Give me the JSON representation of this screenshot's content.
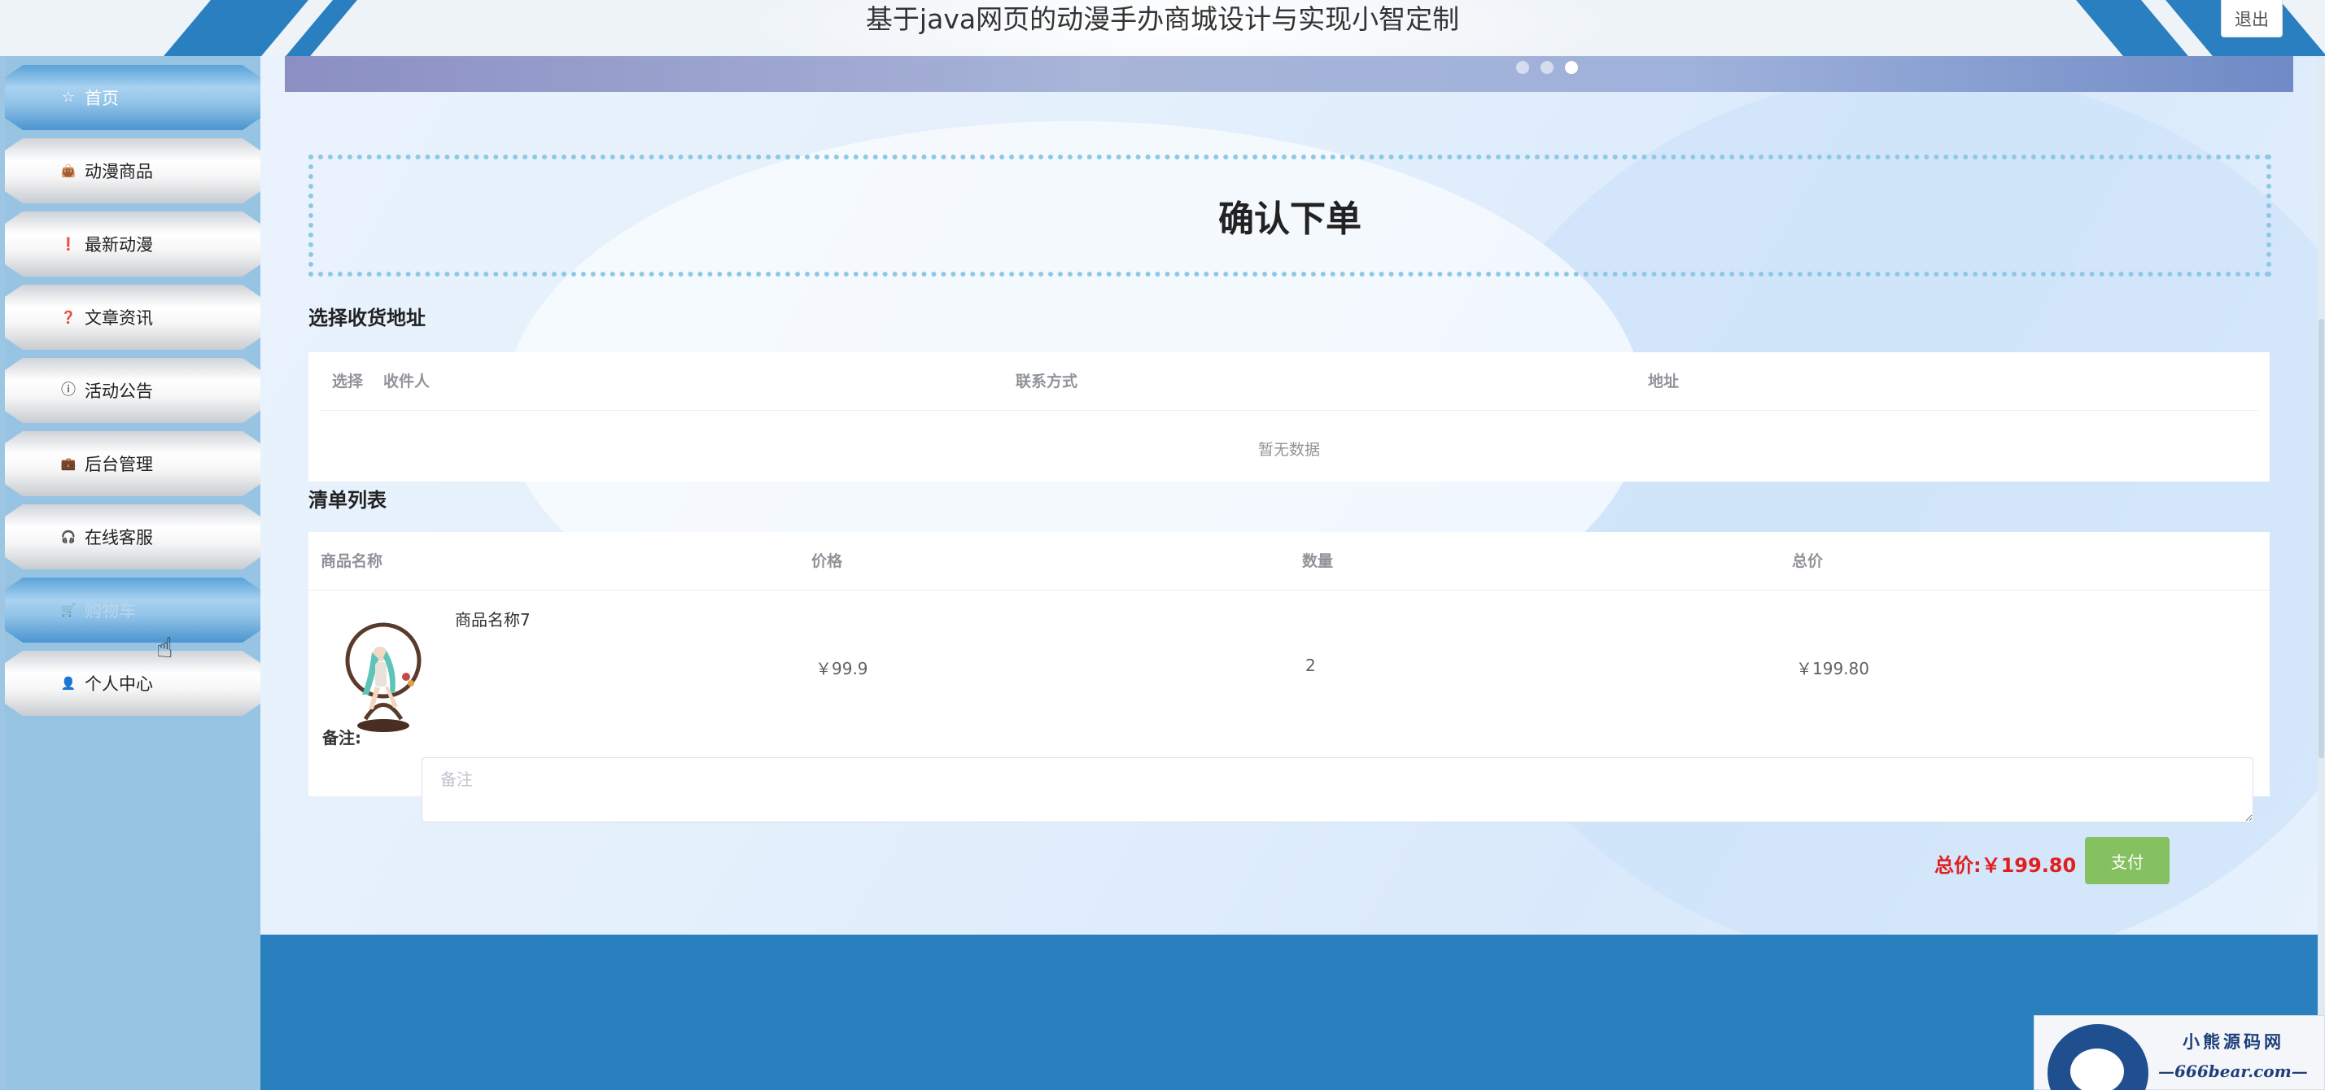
{
  "header": {
    "title": "基于java网页的动漫手办商城设计与实现小智定制",
    "logout_label": "退出"
  },
  "sidebar": {
    "items": [
      {
        "label": "首页",
        "icon": "star-icon",
        "glyph": "☆",
        "active": true
      },
      {
        "label": "动漫商品",
        "icon": "shopping-bag-icon",
        "glyph": "👜"
      },
      {
        "label": "最新动漫",
        "icon": "exclamation-circle-icon",
        "glyph": "❗"
      },
      {
        "label": "文章资讯",
        "icon": "question-circle-icon",
        "glyph": "❓"
      },
      {
        "label": "活动公告",
        "icon": "info-circle-icon",
        "glyph": "ⓘ"
      },
      {
        "label": "后台管理",
        "icon": "briefcase-icon",
        "glyph": "💼"
      },
      {
        "label": "在线客服",
        "icon": "headset-icon",
        "glyph": "🎧"
      },
      {
        "label": "购物车",
        "icon": "cart-icon",
        "glyph": "🛒",
        "faded": true
      },
      {
        "label": "个人中心",
        "icon": "user-icon",
        "glyph": "👤"
      }
    ]
  },
  "carousel": {
    "dots": 3,
    "active_dot": 3
  },
  "order": {
    "heading": "确认下单",
    "address_section_title": "选择收货地址",
    "address_columns": [
      "选择",
      "收件人",
      "联系方式",
      "地址"
    ],
    "address_empty_text": "暂无数据",
    "list_section_title": "清单列表",
    "list_columns": [
      "商品名称",
      "价格",
      "数量",
      "总价"
    ],
    "items": [
      {
        "name": "商品名称7",
        "price": "￥99.9",
        "quantity": "2",
        "total": "￥199.80"
      }
    ],
    "remark_label": "备注:",
    "remark_placeholder": "备注",
    "remark_value": "",
    "total_label": "总价:￥199.80",
    "pay_label": "支付"
  },
  "watermark": {
    "cn_text": "小熊源码网",
    "en_text": "—666bear.com—"
  },
  "colors": {
    "accent_blue": "#2a80bf",
    "pay_green": "#85c161",
    "total_red": "#e02020",
    "dotted_border": "#8ec8e6"
  }
}
